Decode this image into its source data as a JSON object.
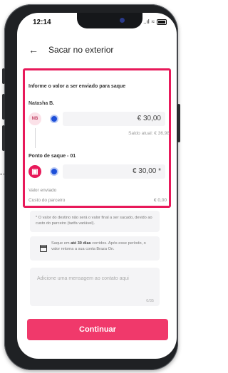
{
  "status": {
    "time": "12:14",
    "signal": "..ıl",
    "wifi": "≈"
  },
  "header": {
    "back_icon": "arrow-left-icon",
    "title": "Sacar no exterior"
  },
  "form": {
    "prompt": "Informe o valor a ser enviado para saque",
    "sender": {
      "name": "Natasha B.",
      "initials": "NB",
      "amount": "€ 30,00",
      "balance": "Saldo atual: € 36,98"
    },
    "recipient": {
      "name": "Ponto de saque - 01",
      "amount": "€ 30,00 *"
    },
    "sent_label": "Valor enviado",
    "fee_label": "Custo do parceiro",
    "fee_value": "€ 0,00"
  },
  "notices": {
    "disclaimer": "* O valor do destino não será o valor final a ser sacado, devido ao custo do parceiro (tarifa variável).",
    "deadline_prefix": "Saque em ",
    "deadline_bold": "até 30 dias",
    "deadline_suffix": " corridos. Após esse período, o valor retorna a sua conta Braza On."
  },
  "message": {
    "placeholder": "Adicione uma mensagem ao contato aqui",
    "counter": "0/35"
  },
  "cta": {
    "label": "Continuar"
  },
  "colors": {
    "accent": "#e8195a",
    "button": "#f0396b",
    "coin": "#1d4fd8"
  }
}
